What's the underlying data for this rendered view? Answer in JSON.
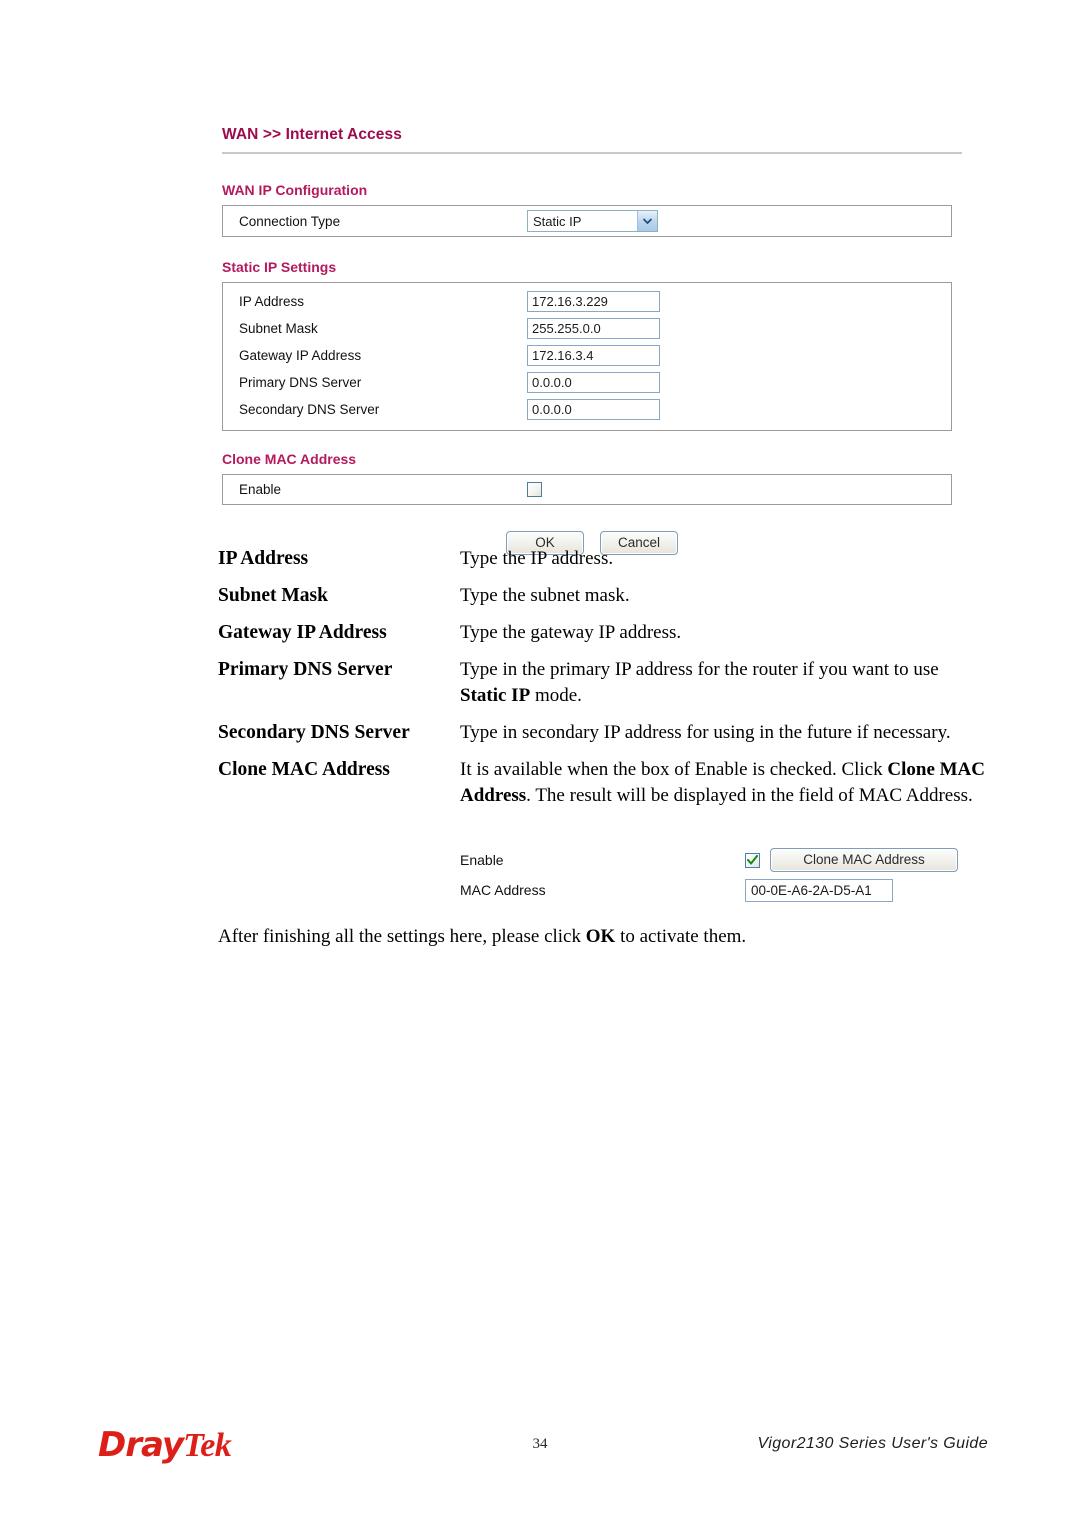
{
  "screenshot": {
    "breadcrumb": "WAN >> Internet Access",
    "sections": {
      "wan_ip_config": {
        "title": "WAN IP Configuration",
        "connection_type_label": "Connection Type",
        "connection_type_value": "Static IP",
        "dropdown_icon": "chevron-down-icon"
      },
      "static_ip": {
        "title": "Static IP Settings",
        "fields": [
          {
            "label": "IP Address",
            "value": "172.16.3.229"
          },
          {
            "label": "Subnet Mask",
            "value": "255.255.0.0"
          },
          {
            "label": "Gateway IP Address",
            "value": "172.16.3.4"
          },
          {
            "label": "Primary DNS Server",
            "value": "0.0.0.0"
          },
          {
            "label": "Secondary DNS Server",
            "value": "0.0.0.0"
          }
        ]
      },
      "clone_mac": {
        "title": "Clone MAC Address",
        "enable_label": "Enable",
        "enable_checked": false
      }
    },
    "buttons": {
      "ok": "OK",
      "cancel": "Cancel"
    }
  },
  "definitions": [
    {
      "term": "IP Address",
      "desc_html": "Type the IP address."
    },
    {
      "term": "Subnet Mask",
      "desc_html": "Type the subnet mask."
    },
    {
      "term": "Gateway IP Address",
      "desc_html": "Type the gateway IP address."
    },
    {
      "term": "Primary DNS Server",
      "desc_html": "Type in the primary IP address for the router if you want to use <b>Static IP</b> mode."
    },
    {
      "term": "Secondary DNS Server",
      "desc_html": "Type in secondary IP address for using in the future if necessary."
    },
    {
      "term": "Clone MAC Address",
      "desc_html": "It is available when the box of Enable is checked. Click <b>Clone MAC Address</b>. The result will be displayed in the field of MAC Address."
    }
  ],
  "inline_screenshot": {
    "enable_label": "Enable",
    "enable_checked": true,
    "check_icon": "check-icon",
    "clone_button_label": "Clone MAC Address",
    "mac_label": "MAC Address",
    "mac_value": "00-0E-A6-2A-D5-A1"
  },
  "closing_html": "After finishing all the settings here, please click <b>OK</b> to activate them.",
  "footer": {
    "logo_part1": "Dray",
    "logo_part2": "Tek",
    "page_number": "34",
    "guide_title": "Vigor2130 Series User's Guide"
  },
  "colors": {
    "breadcrumb": "#9e0b4d",
    "section_heading": "#b5195e",
    "input_border": "#8aa8c6",
    "brand_red": "#dd1f19"
  }
}
